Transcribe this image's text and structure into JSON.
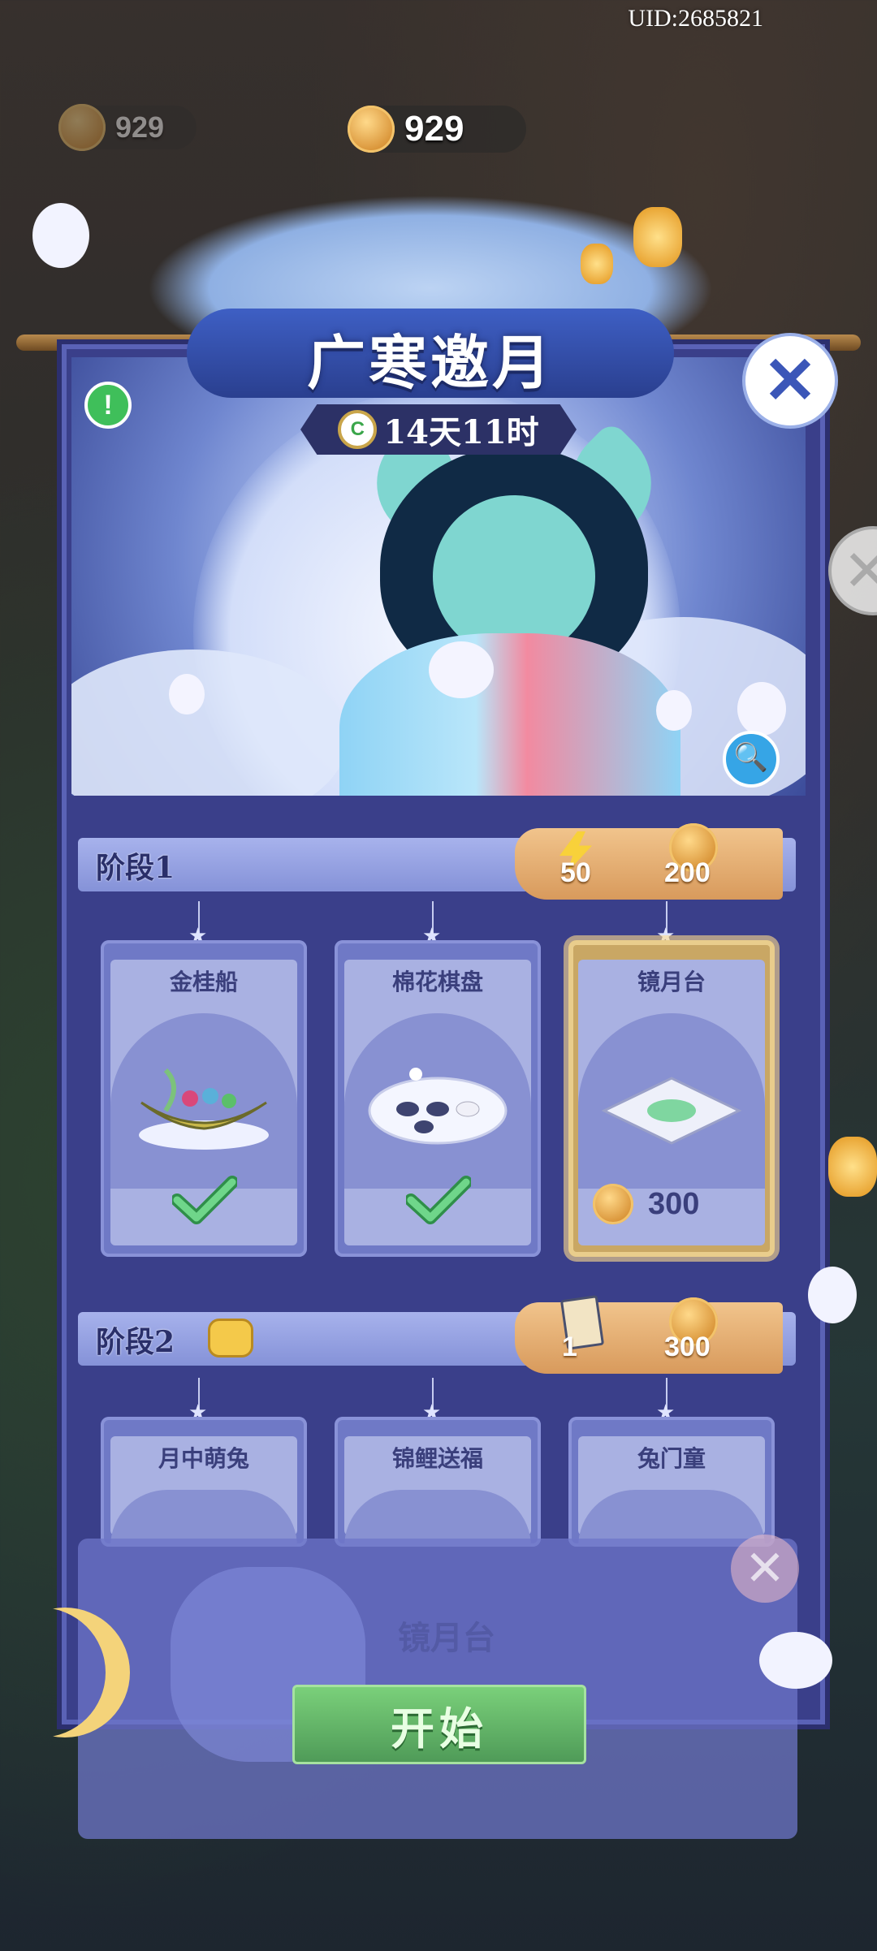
{
  "uid": "UID:2685821",
  "currency": {
    "small_value": "929",
    "main_value": "929"
  },
  "event": {
    "title": "广寒邀月",
    "timer": "14天11时",
    "clock_glyph": "C"
  },
  "buttons": {
    "info": "!",
    "close": "✕",
    "side_close": "✕",
    "zoom": "🔍",
    "start": "开始"
  },
  "stage1": {
    "label": "阶段1",
    "reward_energy": "50",
    "reward_coins": "200",
    "cards": [
      {
        "name": "金桂船",
        "owned": true
      },
      {
        "name": "棉花棋盘",
        "owned": true
      },
      {
        "name": "镜月台",
        "owned": false,
        "price": "300"
      }
    ]
  },
  "stage2": {
    "label": "阶段2",
    "reward_cards": "1",
    "reward_coins": "300",
    "cards": [
      {
        "name": "月中萌兔"
      },
      {
        "name": "锦鲤送福"
      },
      {
        "name": "兔门童"
      }
    ]
  },
  "overlay": {
    "ghost_label": "镜月台",
    "close": "✕"
  },
  "colors": {
    "panel": "#3a3f8a",
    "accent_gold": "#d89a5c",
    "start_green": "#5aa862"
  }
}
